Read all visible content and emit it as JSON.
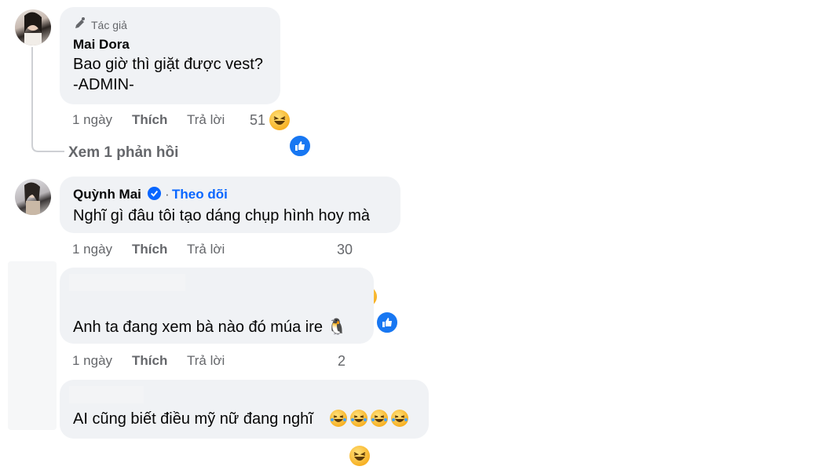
{
  "comments": [
    {
      "author_badge": "Tác giả",
      "name": "Mai Dora",
      "lines": [
        "Bao giờ thì giặt được vest?",
        "-ADMIN-"
      ],
      "time": "1 ngày",
      "like": "Thích",
      "reply": "Trả lời",
      "reaction_count": "51",
      "reactions": [
        "haha",
        "like"
      ]
    },
    {
      "view_replies": "Xem 1 phản hồi"
    },
    {
      "name": "Quỳnh Mai",
      "verified": true,
      "dot": "·",
      "follow": "Theo dõi",
      "text": "Nghĩ gì đâu tôi tạo dáng chụp hình hoy mà",
      "time": "1 ngày",
      "like": "Thích",
      "reply": "Trả lời",
      "reaction_count": "30",
      "reactions": [
        "haha",
        "like"
      ]
    },
    {
      "text": "Anh ta đang xem bà nào đó múa ire 🐧",
      "time": "1 ngày",
      "like": "Thích",
      "reply": "Trả lời",
      "reaction_count": "2",
      "reactions": [
        "haha"
      ]
    },
    {
      "text": "AI cũng biết điều mỹ nữ đang nghĩ"
    }
  ],
  "colors": {
    "bubble": "#f0f2f5",
    "meta": "#65676b",
    "link": "#0866ff",
    "like": "#1877f2"
  }
}
